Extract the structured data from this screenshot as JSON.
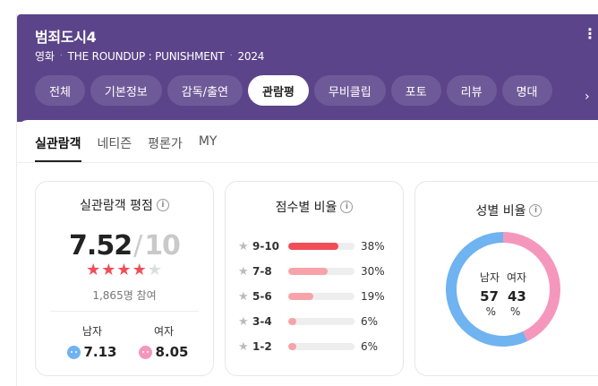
{
  "header": {
    "title": "범죄도시4",
    "meta": [
      "영화",
      "THE ROUNDUP : PUNISHMENT",
      "2024"
    ],
    "tabs": [
      "전체",
      "기본정보",
      "감독/출연",
      "관람평",
      "무비클립",
      "포토",
      "리뷰",
      "명대"
    ],
    "active_tab": "관람평"
  },
  "subtabs": [
    "실관람객",
    "네티즌",
    "평론가",
    "MY"
  ],
  "rating_card": {
    "title": "실관람객 평점",
    "score": "7.52",
    "slash": "/",
    "max": "10",
    "stars_filled": 4,
    "stars_total": 5,
    "participants": "1,865명 참여",
    "male_label": "남자",
    "male_score": "7.13",
    "female_label": "여자",
    "female_score": "8.05"
  },
  "distribution_card": {
    "title": "점수별 비율",
    "rows": [
      {
        "range": "9-10",
        "percent": 38,
        "label": "38%"
      },
      {
        "range": "7-8",
        "percent": 30,
        "label": "30%"
      },
      {
        "range": "5-6",
        "percent": 19,
        "label": "19%"
      },
      {
        "range": "3-4",
        "percent": 6,
        "label": "6%"
      },
      {
        "range": "1-2",
        "percent": 6,
        "label": "6%"
      }
    ],
    "colors": {
      "top": "#f24c59",
      "other": "#f7a3a9",
      "track": "#eeeeee"
    }
  },
  "gender_card": {
    "title": "성별 비율",
    "male_label": "남자",
    "female_label": "여자",
    "male_percent": "57",
    "female_percent": "43",
    "unit": "%",
    "colors": {
      "male": "#6fb3f0",
      "female": "#f597bd"
    }
  },
  "colors": {
    "header": "#5b4489",
    "star": "#f24c59"
  }
}
